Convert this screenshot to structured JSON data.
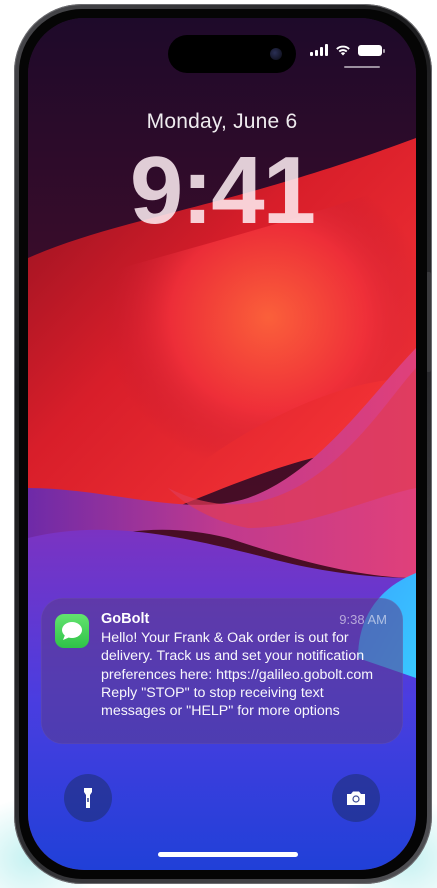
{
  "lock_screen": {
    "date": "Monday, June 6",
    "time": "9:41"
  },
  "notification": {
    "app_name": "GoBolt",
    "time": "9:38 AM",
    "app_icon": "messages-icon",
    "body_lines": [
      "Hello! Your Frank & Oak order is out for",
      "delivery. Track us and set your notification",
      "preferences here: https://galileo.gobolt.com",
      "Reply \"STOP\" to stop receiving text",
      "messages or \"HELP\" for more options"
    ]
  },
  "status_bar": {
    "icons": [
      "cellular-signal-icon",
      "wifi-icon",
      "battery-icon"
    ]
  },
  "controls": {
    "left": "flashlight-icon",
    "right": "camera-icon"
  },
  "colors": {
    "messages_green": "#34C759",
    "wallpaper_red": "#E0252E",
    "wallpaper_purple": "#7A2FC0",
    "wallpaper_blue": "#2F56E0"
  }
}
